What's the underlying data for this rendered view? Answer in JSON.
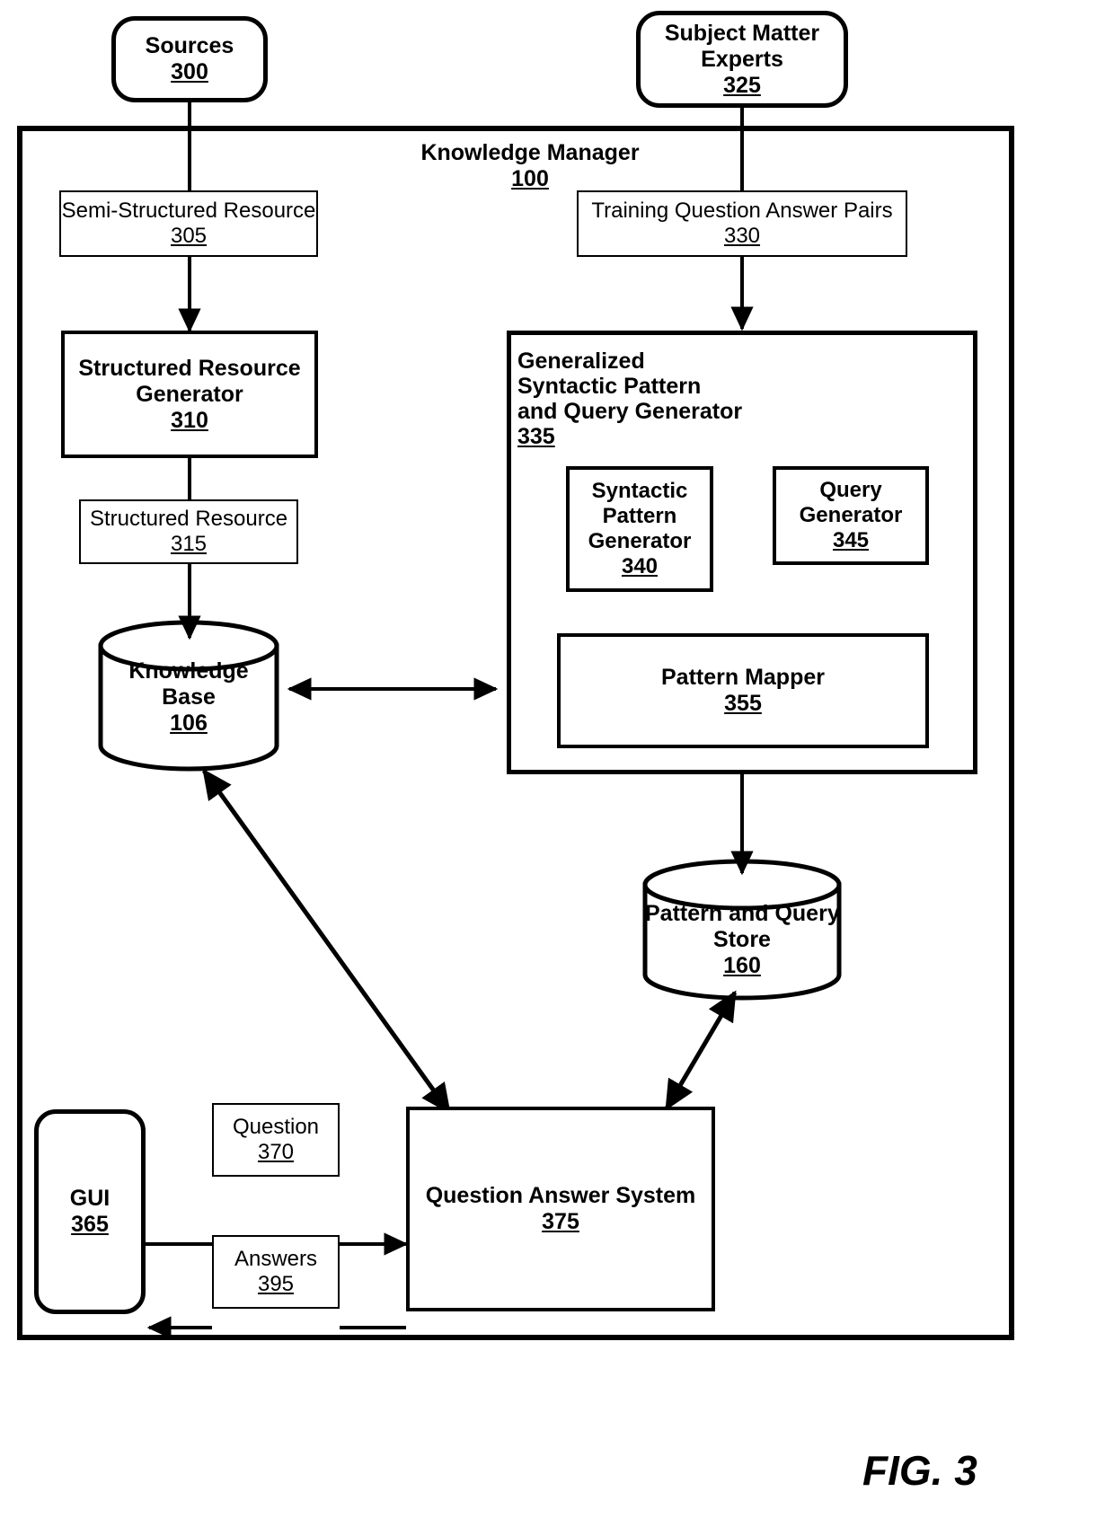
{
  "figure": {
    "label": "FIG. 3"
  },
  "container": {
    "title": "Knowledge Manager",
    "number": "100"
  },
  "nodes": {
    "sources": {
      "label": "Sources",
      "number": "300"
    },
    "subject_matter_experts": {
      "label_line1": "Subject Matter",
      "label_line2": "Experts",
      "number": "325"
    },
    "semi_structured_resource": {
      "label": "Semi-Structured Resource",
      "number": "305"
    },
    "training_qa_pairs": {
      "label": "Training Question Answer Pairs",
      "number": "330"
    },
    "structured_resource_generator": {
      "label_line1": "Structured Resource",
      "label_line2": "Generator",
      "number": "310"
    },
    "structured_resource": {
      "label": "Structured Resource",
      "number": "315"
    },
    "knowledge_base": {
      "label_line1": "Knowledge",
      "label_line2": "Base",
      "number": "106"
    },
    "generalized_generator": {
      "label_line1": "Generalized",
      "label_line2": "Syntactic Pattern",
      "label_line3": "and Query Generator",
      "number": "335"
    },
    "syntactic_pattern_generator": {
      "label_line1": "Syntactic",
      "label_line2": "Pattern",
      "label_line3": "Generator",
      "number": "340"
    },
    "query_generator": {
      "label_line1": "Query",
      "label_line2": "Generator",
      "number": "345"
    },
    "pattern_mapper": {
      "label": "Pattern Mapper",
      "number": "355"
    },
    "pattern_query_store": {
      "label_line1": "Pattern and Query",
      "label_line2": "Store",
      "number": "160"
    },
    "gui": {
      "label": "GUI",
      "number": "365"
    },
    "question": {
      "label": "Question",
      "number": "370"
    },
    "answers": {
      "label": "Answers",
      "number": "395"
    },
    "question_answer_system": {
      "label": "Question Answer System",
      "number": "375"
    }
  },
  "colors": {
    "stroke": "#000000",
    "background": "#ffffff"
  },
  "chart_data": {
    "type": "diagram",
    "title": "Knowledge Manager block diagram",
    "edges": [
      {
        "from": "sources",
        "to": "semi_structured_resource",
        "style": "plain-line"
      },
      {
        "from": "semi_structured_resource",
        "to": "structured_resource_generator",
        "style": "arrow"
      },
      {
        "from": "structured_resource_generator",
        "to": "structured_resource",
        "style": "plain-line"
      },
      {
        "from": "structured_resource",
        "to": "knowledge_base",
        "style": "arrow"
      },
      {
        "from": "subject_matter_experts",
        "to": "training_qa_pairs",
        "style": "plain-line"
      },
      {
        "from": "training_qa_pairs",
        "to": "generalized_generator",
        "style": "arrow"
      },
      {
        "from": "knowledge_base",
        "to": "generalized_generator",
        "style": "double-arrow"
      },
      {
        "from": "syntactic_pattern_generator",
        "to": "pattern_mapper",
        "style": "arrow"
      },
      {
        "from": "query_generator",
        "to": "pattern_mapper",
        "style": "arrow"
      },
      {
        "from": "pattern_mapper",
        "to": "pattern_query_store",
        "style": "arrow"
      },
      {
        "from": "knowledge_base",
        "to": "question_answer_system",
        "style": "double-arrow-diagonal"
      },
      {
        "from": "pattern_query_store",
        "to": "question_answer_system",
        "style": "double-arrow-diagonal"
      },
      {
        "from": "gui",
        "to": "question",
        "style": "plain-line"
      },
      {
        "from": "question",
        "to": "question_answer_system",
        "style": "arrow"
      },
      {
        "from": "question_answer_system",
        "to": "answers",
        "style": "plain-line"
      },
      {
        "from": "answers",
        "to": "gui",
        "style": "arrow"
      }
    ]
  }
}
